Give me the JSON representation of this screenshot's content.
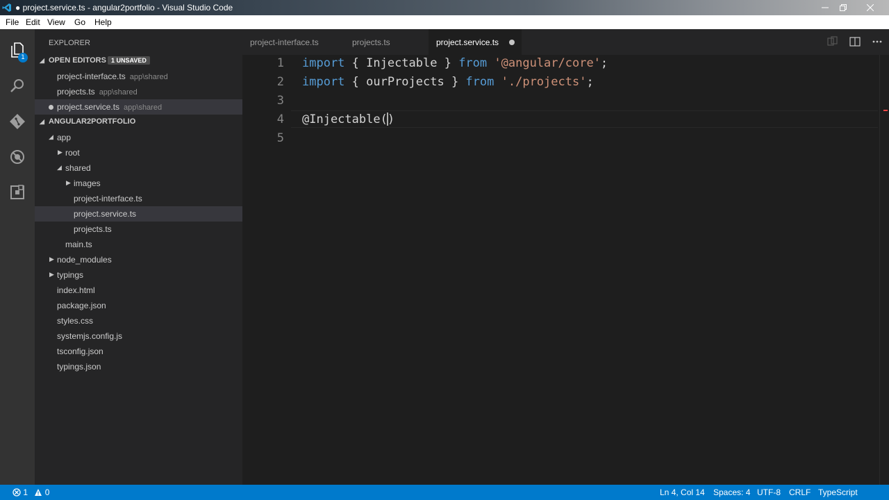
{
  "window": {
    "title": "● project.service.ts - angular2portfolio - Visual Studio Code"
  },
  "menu": [
    "File",
    "Edit",
    "View",
    "Go",
    "Help"
  ],
  "activity_bar": {
    "items": [
      "explorer-icon",
      "search-icon",
      "git-icon",
      "debug-icon",
      "extensions-icon"
    ],
    "explorer_badge": "1"
  },
  "sidebar": {
    "title": "EXPLORER",
    "open_editors": {
      "label": "OPEN EDITORS",
      "badge": "1 UNSAVED",
      "items": [
        {
          "name": "project-interface.ts",
          "desc": "app\\shared",
          "modified": false
        },
        {
          "name": "projects.ts",
          "desc": "app\\shared",
          "modified": false
        },
        {
          "name": "project.service.ts",
          "desc": "app\\shared",
          "modified": true
        }
      ]
    },
    "project": {
      "label": "ANGULAR2PORTFOLIO",
      "tree": [
        {
          "name": "app",
          "depth": 1,
          "kind": "folder-open"
        },
        {
          "name": "root",
          "depth": 2,
          "kind": "folder"
        },
        {
          "name": "shared",
          "depth": 2,
          "kind": "folder-open"
        },
        {
          "name": "images",
          "depth": 3,
          "kind": "folder"
        },
        {
          "name": "project-interface.ts",
          "depth": 3,
          "kind": "file"
        },
        {
          "name": "project.service.ts",
          "depth": 3,
          "kind": "file",
          "selected": true
        },
        {
          "name": "projects.ts",
          "depth": 3,
          "kind": "file"
        },
        {
          "name": "main.ts",
          "depth": 2,
          "kind": "file"
        },
        {
          "name": "node_modules",
          "depth": 1,
          "kind": "folder"
        },
        {
          "name": "typings",
          "depth": 1,
          "kind": "folder"
        },
        {
          "name": "index.html",
          "depth": 1,
          "kind": "file"
        },
        {
          "name": "package.json",
          "depth": 1,
          "kind": "file"
        },
        {
          "name": "styles.css",
          "depth": 1,
          "kind": "file"
        },
        {
          "name": "systemjs.config.js",
          "depth": 1,
          "kind": "file"
        },
        {
          "name": "tsconfig.json",
          "depth": 1,
          "kind": "file"
        },
        {
          "name": "typings.json",
          "depth": 1,
          "kind": "file"
        }
      ]
    }
  },
  "tabs": [
    {
      "label": "project-interface.ts",
      "active": false,
      "modified": false
    },
    {
      "label": "projects.ts",
      "active": false,
      "modified": false
    },
    {
      "label": "project.service.ts",
      "active": true,
      "modified": true
    }
  ],
  "editor": {
    "lines": [
      {
        "num": "1",
        "tokens": [
          [
            "kw",
            "import"
          ],
          [
            "pl",
            " { Injectable } "
          ],
          [
            "kw",
            "from"
          ],
          [
            "pl",
            " "
          ],
          [
            "str",
            "'@angular/core'"
          ],
          [
            "pl",
            ";"
          ]
        ]
      },
      {
        "num": "2",
        "tokens": [
          [
            "kw",
            "import"
          ],
          [
            "pl",
            " { ourProjects } "
          ],
          [
            "kw",
            "from"
          ],
          [
            "pl",
            " "
          ],
          [
            "str",
            "'./projects'"
          ],
          [
            "pl",
            ";"
          ]
        ]
      },
      {
        "num": "3",
        "tokens": []
      },
      {
        "num": "4",
        "tokens": [
          [
            "dec",
            "@Injectable("
          ],
          [
            "cursor",
            ""
          ],
          [
            "dec",
            ")"
          ]
        ]
      },
      {
        "num": "5",
        "tokens": []
      }
    ]
  },
  "status": {
    "errors": "1",
    "warnings": "0",
    "position": "Ln 4, Col 14",
    "spaces": "Spaces: 4",
    "encoding": "UTF-8",
    "eol": "CRLF",
    "language": "TypeScript"
  },
  "colors": {
    "accent": "#007acc",
    "keyword": "#569cd6",
    "string": "#ce9178"
  }
}
